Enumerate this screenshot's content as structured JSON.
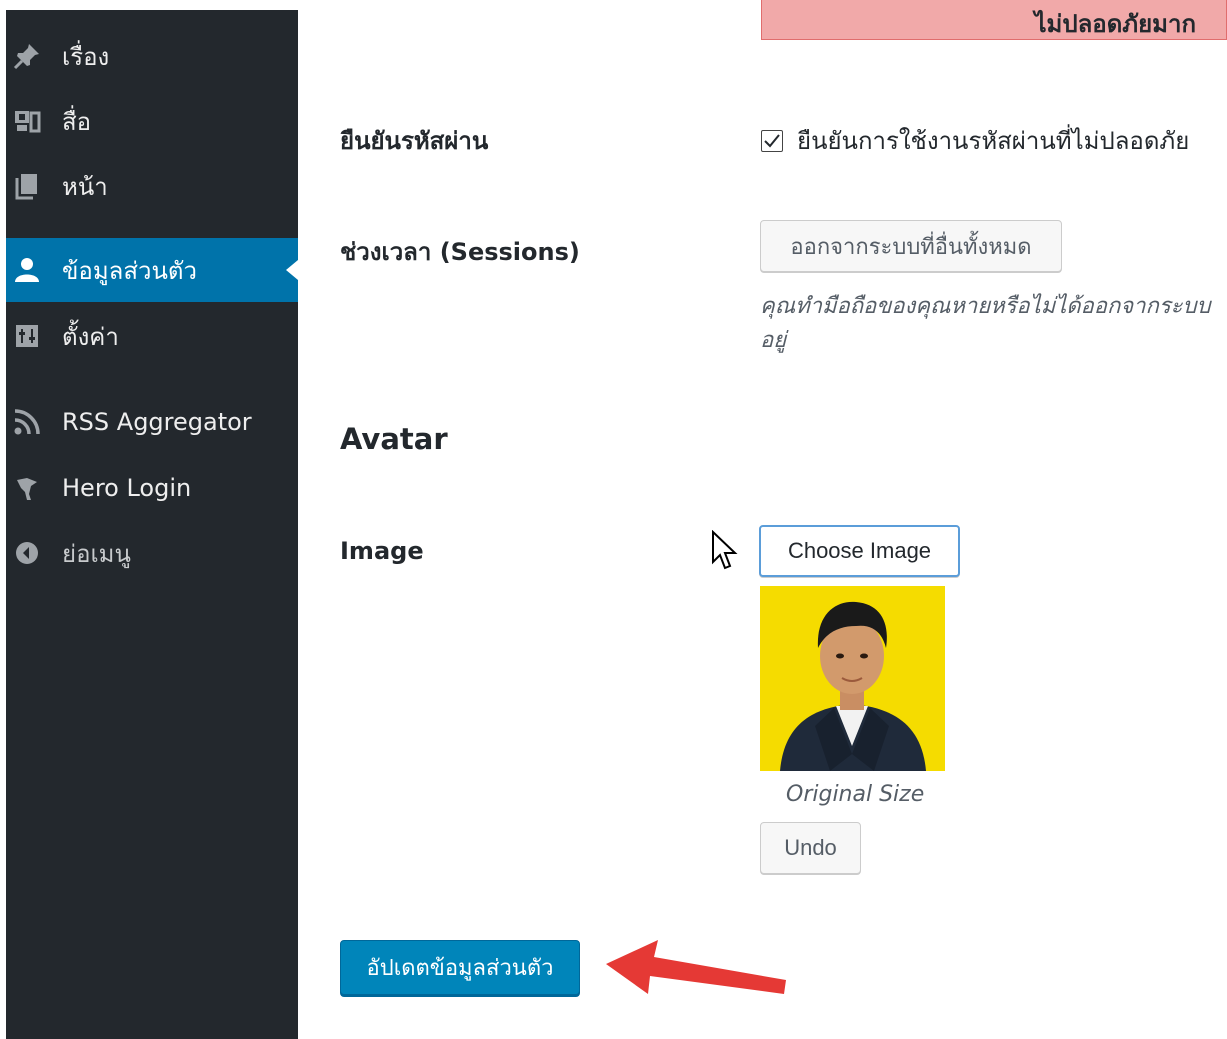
{
  "sidebar": {
    "items": [
      {
        "label": "เรื่อง",
        "icon": "pin-icon"
      },
      {
        "label": "สื่อ",
        "icon": "media-icon"
      },
      {
        "label": "หน้า",
        "icon": "page-icon"
      },
      {
        "label": "ข้อมูลส่วนตัว",
        "icon": "user-icon",
        "active": true
      },
      {
        "label": "ตั้งค่า",
        "icon": "settings-icon"
      },
      {
        "label": "RSS Aggregator",
        "icon": "rss-icon"
      },
      {
        "label": "Hero Login",
        "icon": "hero-icon"
      },
      {
        "label": "ย่อเมนู",
        "icon": "collapse-icon"
      }
    ]
  },
  "top_notice": {
    "text": "ไม่ปลอดภัยมาก"
  },
  "confirm_password": {
    "label": "ยืนยันรหัสผ่าน",
    "checkbox_text": "ยืนยันการใช้งานรหัสผ่านที่ไม่ปลอดภัย",
    "checked": true
  },
  "sessions": {
    "label": "ช่วงเวลา (Sessions)",
    "button_label": "ออกจากระบบที่อื่นทั้งหมด",
    "description_line1": "คุณทำมือถือของคุณหายหรือไม่ได้ออกจากระบบ",
    "description_line2": "อยู่"
  },
  "avatar": {
    "heading": "Avatar",
    "image_label": "Image",
    "choose_button": "Choose Image",
    "caption": "Original Size",
    "undo_button": "Undo"
  },
  "submit": {
    "label": "อัปเดตข้อมูลส่วนตัว"
  },
  "colors": {
    "sidebar_bg": "#23282d",
    "active_bg": "#0073aa",
    "primary_button": "#0085ba",
    "notice_bg": "#f1a9a9",
    "photo_bg": "#f5dc00",
    "arrow": "#e53935"
  }
}
